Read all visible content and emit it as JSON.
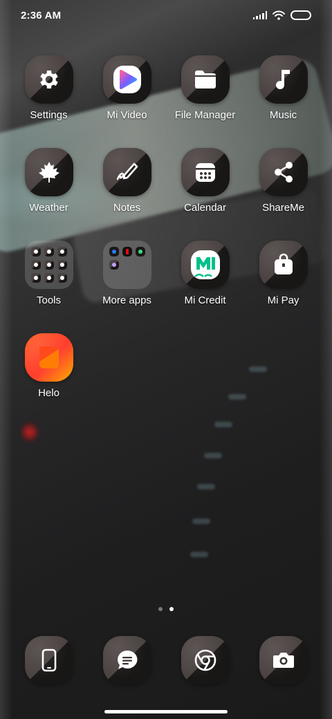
{
  "status_bar": {
    "time": "2:36 AM",
    "icons": [
      "signal-icon",
      "wifi-icon",
      "battery-icon"
    ]
  },
  "apps": [
    {
      "label": "Settings",
      "icon": "gear-icon"
    },
    {
      "label": "Mi Video",
      "icon": "mi-video-icon"
    },
    {
      "label": "File Manager",
      "icon": "folder-icon"
    },
    {
      "label": "Music",
      "icon": "music-note-icon"
    },
    {
      "label": "Weather",
      "icon": "maple-leaf-icon"
    },
    {
      "label": "Notes",
      "icon": "pen-icon"
    },
    {
      "label": "Calendar",
      "icon": "calendar-icon"
    },
    {
      "label": "ShareMe",
      "icon": "share-icon"
    },
    {
      "label": "Tools",
      "icon": "folder-tools"
    },
    {
      "label": "More apps",
      "icon": "folder-more-apps"
    },
    {
      "label": "Mi Credit",
      "icon": "mi-credit-icon"
    },
    {
      "label": "Mi Pay",
      "icon": "shopping-bag-icon"
    },
    {
      "label": "Helo",
      "icon": "helo-icon"
    }
  ],
  "pages": {
    "count": 2,
    "active": 2
  },
  "dock": [
    {
      "icon": "phone-icon"
    },
    {
      "icon": "messages-icon"
    },
    {
      "icon": "chrome-icon"
    },
    {
      "icon": "camera-icon"
    }
  ],
  "colors": {
    "icon_light": "#4a4240",
    "icon_dark": "#191716",
    "mi_credit_green": "#00c08b",
    "helo_orange": "#ff4a1c"
  }
}
